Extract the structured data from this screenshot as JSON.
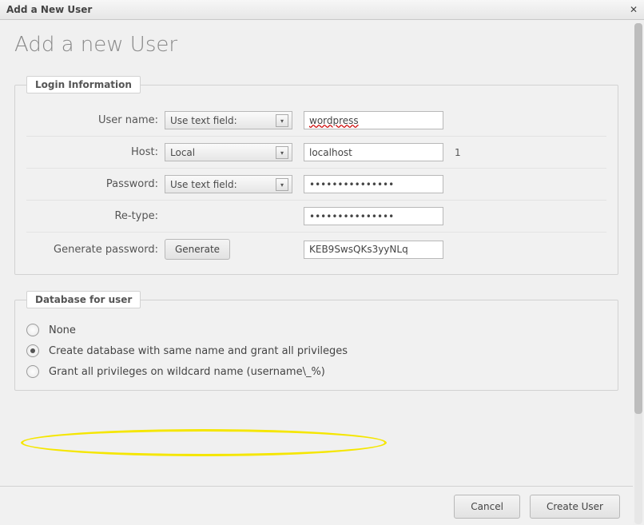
{
  "window_title": "Add a New User",
  "page_heading": "Add a new User",
  "login_legend": "Login Information",
  "labels": {
    "username": "User name:",
    "host": "Host:",
    "password": "Password:",
    "retype": "Re-type:",
    "generate": "Generate password:"
  },
  "selects": {
    "username_mode": "Use text field:",
    "host_mode": "Local",
    "password_mode": "Use text field:"
  },
  "values": {
    "username": "wordpress",
    "host": "localhost",
    "password_mask": "•••••••••••••••",
    "retype_mask": "•••••••••••••••",
    "generated": "KEB9SwsQKs3yyNLq"
  },
  "host_note": "1",
  "generate_button": "Generate",
  "db_legend": "Database for user",
  "db_options": {
    "none": "None",
    "create_same": "Create database with same name and grant all privileges",
    "wildcard": "Grant all privileges on wildcard name (username\\_%)"
  },
  "db_selected": "create_same",
  "footer": {
    "cancel": "Cancel",
    "create": "Create User"
  }
}
